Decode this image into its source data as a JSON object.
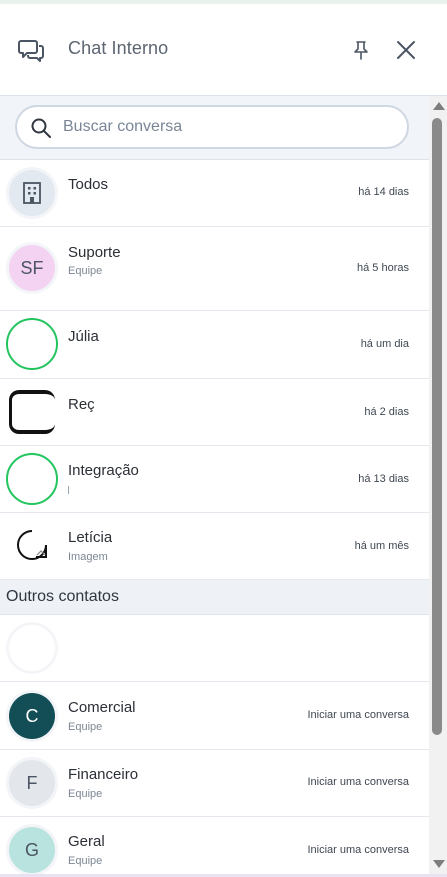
{
  "header": {
    "title": "Chat Interno",
    "icons": {
      "chat": "chat-bubbles-icon",
      "pin": "pin-icon",
      "close": "close-icon"
    }
  },
  "search": {
    "placeholder": "Buscar conversa",
    "value": ""
  },
  "conversations": [
    {
      "name": "Todos",
      "subtitle": "",
      "time": "há 14 dias",
      "avatar": {
        "type": "icon",
        "icon": "building-icon",
        "bg": "#e3e9f1"
      }
    },
    {
      "name": "Suporte",
      "subtitle": "Equipe",
      "time": "há 5 horas",
      "avatar": {
        "type": "initials",
        "initials": "SF",
        "bg": "#f3d3f1"
      }
    },
    {
      "name": "Júlia",
      "subtitle": "",
      "time": "há um dia",
      "avatar": {
        "type": "ring",
        "ring": "#22c55e"
      }
    },
    {
      "name": "Reç",
      "subtitle": "",
      "time": "há 2 dias",
      "avatar": {
        "type": "photo"
      }
    },
    {
      "name": "Integração",
      "subtitle": "",
      "time": "há 13 dias",
      "avatar": {
        "type": "ring",
        "ring": "#22c55e"
      }
    },
    {
      "name": "Letícia",
      "subtitle": "Imagem",
      "time": "há um mês",
      "avatar": {
        "type": "sketch"
      }
    }
  ],
  "others": {
    "title": "Outros contatos",
    "contacts": [
      {
        "name": "",
        "subtitle": "",
        "action": "",
        "avatar": {
          "type": "blank"
        }
      },
      {
        "name": "Comercial",
        "subtitle": "Equipe",
        "action": "Iniciar uma conversa",
        "avatar": {
          "type": "initials",
          "initials": "C",
          "bg": "#134e56",
          "fg": "#ffffff"
        }
      },
      {
        "name": "Financeiro",
        "subtitle": "Equipe",
        "action": "Iniciar uma conversa",
        "avatar": {
          "type": "initials",
          "initials": "F",
          "bg": "#e3e7ec",
          "fg": "#4b5563"
        }
      },
      {
        "name": "Geral",
        "subtitle": "Equipe",
        "action": "Iniciar uma conversa",
        "avatar": {
          "type": "initials",
          "initials": "G",
          "bg": "#b9e3de",
          "fg": "#4b5563"
        }
      }
    ]
  },
  "colors": {
    "online_ring": "#22c55e",
    "accent_dark": "#134e56"
  }
}
